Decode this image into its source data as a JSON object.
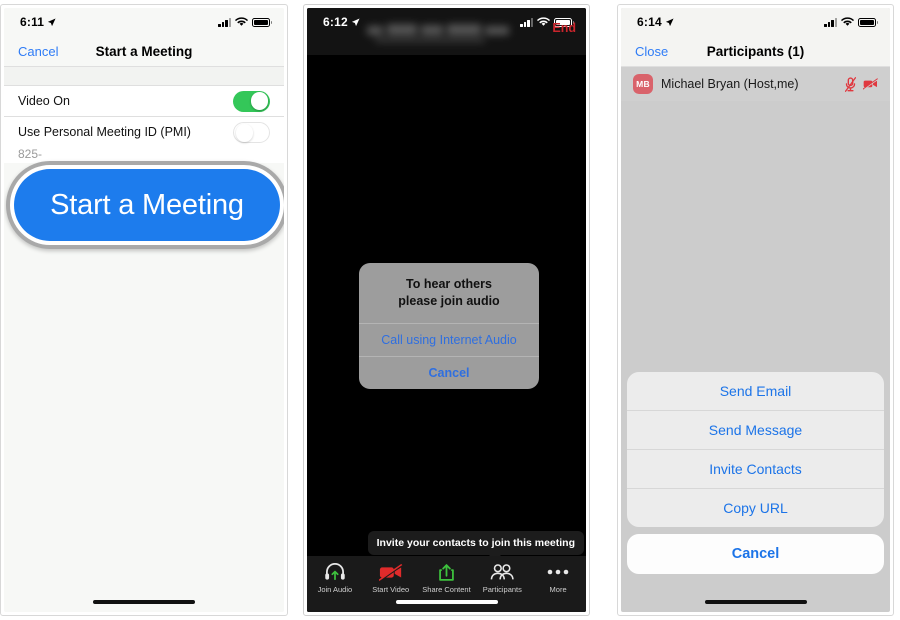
{
  "panel1": {
    "status": {
      "time": "6:11"
    },
    "nav": {
      "left_label": "Cancel",
      "title": "Start a Meeting"
    },
    "rows": [
      {
        "label": "Video On",
        "toggle": "on"
      },
      {
        "label": "Use Personal Meeting ID (PMI)",
        "toggle": "off",
        "sub": "825-"
      }
    ],
    "cta": {
      "label": "Start a Meeting"
    }
  },
  "panel2": {
    "status": {
      "time": "6:12"
    },
    "nav": {
      "end_label": "End",
      "title_redacted": true
    },
    "alert": {
      "message_line1": "To hear others",
      "message_line2": "please join audio",
      "primary_label": "Call using Internet Audio",
      "cancel_label": "Cancel"
    },
    "tooltip": {
      "text": "Invite your contacts to join this meeting"
    },
    "toolbar": [
      {
        "label": "Join Audio",
        "icon": "headset-icon"
      },
      {
        "label": "Start Video",
        "icon": "video-off-icon"
      },
      {
        "label": "Share Content",
        "icon": "share-up-icon"
      },
      {
        "label": "Participants",
        "icon": "participants-icon"
      },
      {
        "label": "More",
        "icon": "more-dots-icon"
      }
    ]
  },
  "panel3": {
    "status": {
      "time": "6:14"
    },
    "nav": {
      "left_label": "Close",
      "title": "Participants (1)"
    },
    "participant": {
      "initials": "MB",
      "name": "Michael Bryan (Host,me)",
      "muted": true,
      "video_off": true
    },
    "action_sheet": {
      "items": [
        "Send Email",
        "Send Message",
        "Invite Contacts",
        "Copy URL"
      ],
      "cancel_label": "Cancel"
    }
  },
  "colors": {
    "ios_blue": "#2f7cf6",
    "sheet_blue": "#1c74e8",
    "cta_blue": "#1d7ced",
    "switch_green": "#34c759",
    "end_red": "#c9252c",
    "avatar_red": "#d9636b",
    "video_red": "#e02b2b",
    "share_green": "#3dc13d"
  }
}
